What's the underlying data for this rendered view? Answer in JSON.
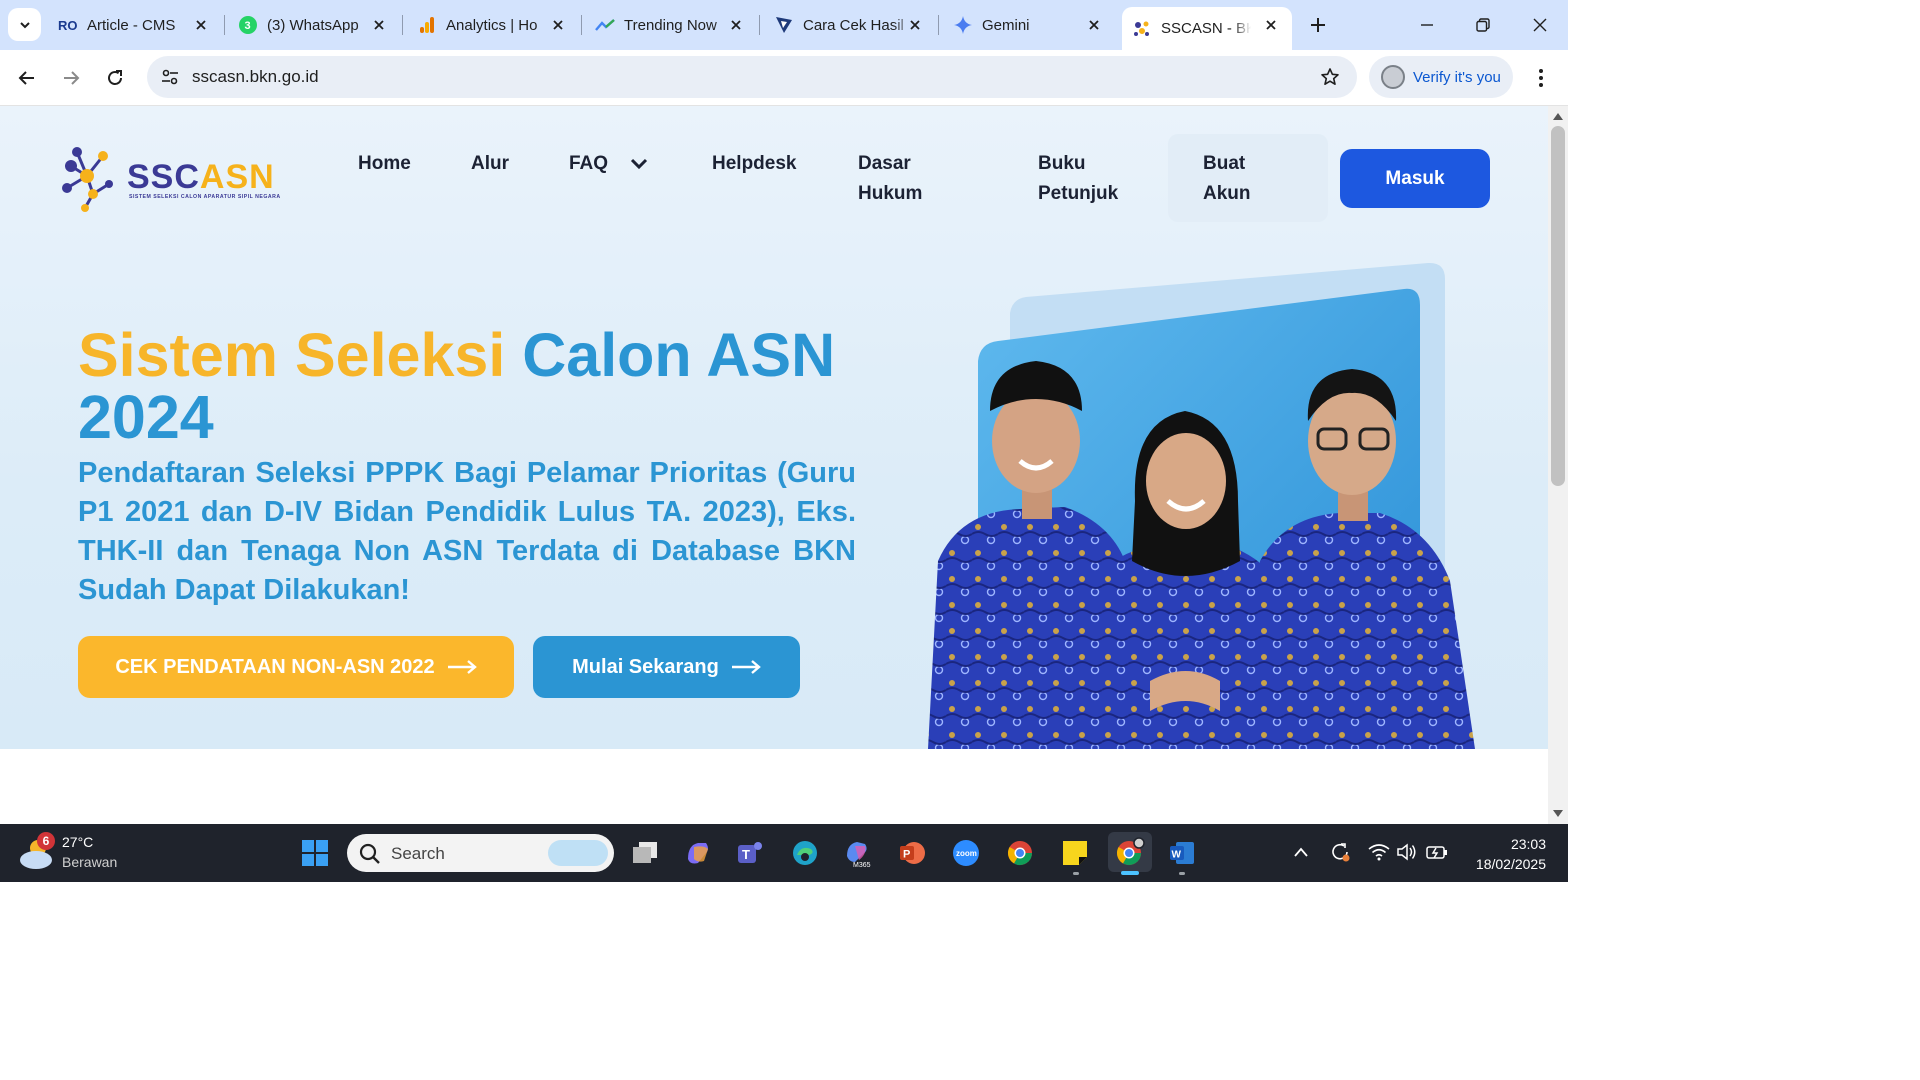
{
  "browser": {
    "tabs": [
      {
        "title": "Article - CMS",
        "favicon": "ro-icon",
        "active": false
      },
      {
        "title": "(3) WhatsApp",
        "favicon": "whatsapp-icon",
        "active": false
      },
      {
        "title": "Analytics | Ho",
        "favicon": "analytics-icon",
        "active": false
      },
      {
        "title": "Trending Now",
        "favicon": "trends-icon",
        "active": false
      },
      {
        "title": "Cara Cek Hasil",
        "favicon": "article-icon",
        "active": false
      },
      {
        "title": "Gemini",
        "favicon": "gemini-icon",
        "active": false
      },
      {
        "title": "SSCASN - BKN",
        "favicon": "sscasn-icon",
        "active": true
      }
    ],
    "url": "sscasn.bkn.go.id",
    "profile_label": "Verify it's you"
  },
  "site": {
    "logo_text_main": "SSC",
    "logo_text_accent": "ASN",
    "logo_subtitle": "SISTEM SELEKSI CALON APARATUR SIPIL NEGARA",
    "nav": {
      "home": "Home",
      "alur": "Alur",
      "faq": "FAQ",
      "helpdesk": "Helpdesk",
      "dasar_line1": "Dasar",
      "dasar_line2": "Hukum",
      "buku_line1": "Buku",
      "buku_line2": "Petunjuk",
      "buat_line1": "Buat",
      "buat_line2": "Akun",
      "masuk": "Masuk"
    },
    "hero": {
      "title_part1": "Sistem Seleksi",
      "title_part2": "Calon ASN",
      "title_year": "2024",
      "subtitle": "Pendaftaran Seleksi PPPK Bagi Pelamar Prioritas (Guru P1 2021 dan D-IV Bidan Pendidik Lulus TA. 2023), Eks. THK-II dan Tenaga Non ASN Terdata di Database BKN Sudah Dapat Dilakukan!",
      "btn_cek": "CEK PENDATAAN NON-ASN 2022",
      "btn_mulai": "Mulai Sekarang"
    }
  },
  "taskbar": {
    "weather_badge": "6",
    "temperature": "27°C",
    "condition": "Berawan",
    "search_label": "Search",
    "time": "23:03",
    "date": "18/02/2025"
  },
  "colors": {
    "accent_blue": "#2b95d3",
    "accent_yellow": "#f7b52a",
    "masuk_blue": "#1d58e0",
    "tab_strip": "#d3e3fd"
  }
}
